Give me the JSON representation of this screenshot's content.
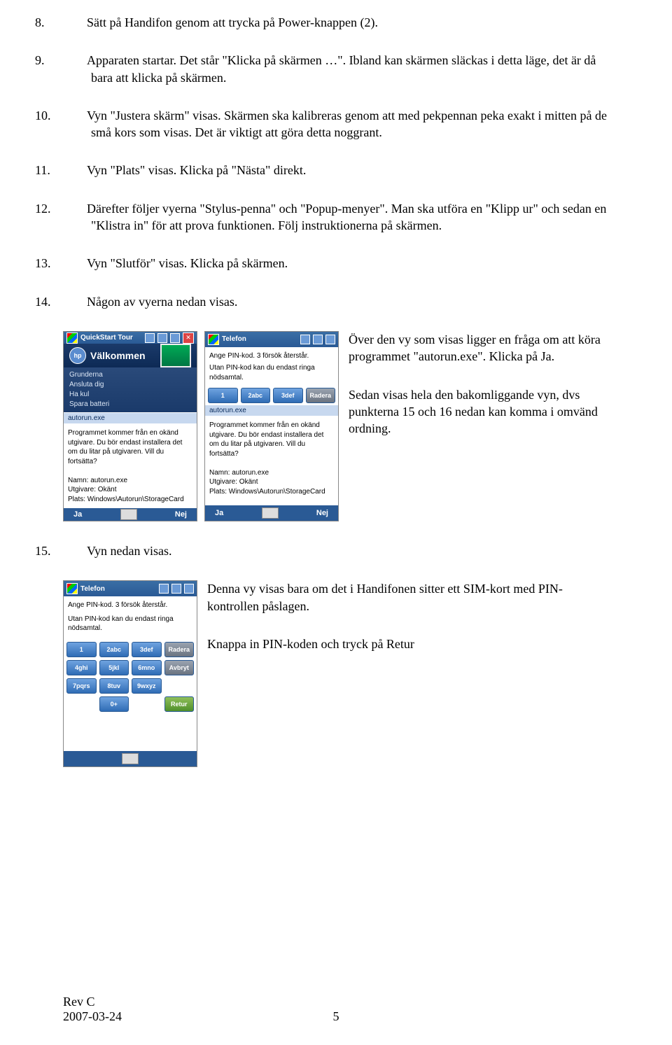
{
  "steps": {
    "s8": {
      "n": "8.",
      "t": "Sätt på Handifon genom att trycka på Power-knappen (2)."
    },
    "s9": {
      "n": "9.",
      "t": "Apparaten startar. Det står \"Klicka på skärmen …\". Ibland kan skärmen släckas i detta läge, det är då bara att klicka på skärmen."
    },
    "s10": {
      "n": "10.",
      "t": "Vyn \"Justera skärm\" visas. Skärmen ska kalibreras genom att med pekpennan peka exakt i mitten på de små kors som visas. Det är viktigt att göra detta noggrant."
    },
    "s11": {
      "n": "11.",
      "t": "Vyn \"Plats\" visas. Klicka på \"Nästa\" direkt."
    },
    "s12": {
      "n": "12.",
      "t": "Därefter följer vyerna \"Stylus-penna\" och \"Popup-menyer\". Man ska utföra en \"Klipp ur\" och sedan en \"Klistra in\" för att prova funktionen. Följ instruktionerna på skärmen."
    },
    "s13": {
      "n": "13.",
      "t": "Vyn \"Slutför\" visas. Klicka på skärmen."
    },
    "s14": {
      "n": "14.",
      "t": "Någon av vyerna nedan visas."
    },
    "s15": {
      "n": "15.",
      "t": "Vyn nedan visas."
    }
  },
  "desc14": {
    "p1": "Över den vy som visas ligger en fråga om att köra programmet \"autorun.exe\". Klicka på Ja.",
    "p2": "Sedan visas hela den bakomliggande vyn, dvs punkterna 15 och 16 nedan kan komma i omvänd ordning."
  },
  "desc15": {
    "p1": "Denna vy visas bara om det i Handifonen sitter ett SIM-kort med PIN-kontrollen påslagen.",
    "p2": "Knappa in PIN-koden och tryck på Retur"
  },
  "shotA": {
    "title": "QuickStart Tour",
    "welcome": "Välkommen",
    "list": [
      "Grunderna",
      "Ansluta dig",
      "Ha kul",
      "Spara batteri"
    ],
    "apptitle": "autorun.exe",
    "msg": "Programmet kommer från en okänd utgivare. Du bör endast installera det om du litar på utgivaren. Vill du fortsätta?",
    "name": "Namn: autorun.exe",
    "pub": "Utgivare: Okänt",
    "loc": "Plats: Windows\\Autorun\\StorageCard",
    "yes": "Ja",
    "no": "Nej"
  },
  "shotB": {
    "title": "Telefon",
    "pin": "Ange PIN-kod. 3 försök återstår.",
    "info": "Utan PIN-kod kan du endast ringa nödsamtal.",
    "keys": [
      "1",
      "2abc",
      "3def",
      "Radera"
    ],
    "apptitle": "autorun.exe",
    "msg": "Programmet kommer från en okänd utgivare. Du bör endast installera det om du litar på utgivaren. Vill du fortsätta?",
    "name": "Namn: autorun.exe",
    "pub": "Utgivare: Okänt",
    "loc": "Plats: Windows\\Autorun\\StorageCard",
    "yes": "Ja",
    "no": "Nej"
  },
  "shotC": {
    "title": "Telefon",
    "pin": "Ange PIN-kod. 3 försök återstår.",
    "info": "Utan PIN-kod kan du endast ringa nödsamtal.",
    "rows": [
      [
        "1",
        "2abc",
        "3def",
        "Radera"
      ],
      [
        "4ghi",
        "5jkl",
        "6mno",
        "Avbryt"
      ],
      [
        "7pqrs",
        "8tuv",
        "9wxyz",
        ""
      ],
      [
        "",
        "0+",
        "",
        "Retur"
      ]
    ]
  },
  "footer": {
    "rev": "Rev C",
    "date": "2007-03-24",
    "page": "5"
  }
}
